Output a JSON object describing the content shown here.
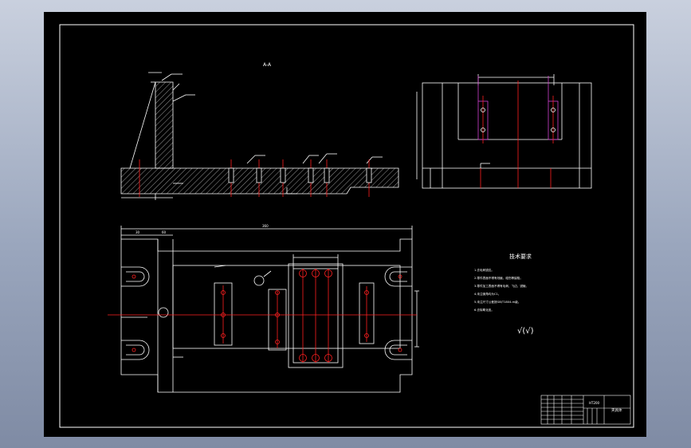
{
  "drawing": {
    "section_label": "A-A",
    "notes_title": "技术要求",
    "notes": [
      "1.去毛刺锐边。",
      "2.零件表面不得有划痕、碰伤等缺陷。",
      "3.零件加工表面不得有毛刺、飞边、锐棱。",
      "4.未注倒角均为C1。",
      "5.未注尺寸公差按GB/T1804-m级。",
      "6.去除氧化皮。"
    ],
    "roughness_symbol": "√(√)",
    "title_block": {
      "part_name": "夹具体",
      "material": "HT200"
    },
    "dimensions": {
      "overall_length": "360",
      "left_offset": "30",
      "pad_width": "60"
    }
  },
  "colors": {
    "background": "#000000",
    "outline": "#ffffff",
    "centerline": "#ff2020",
    "hole_circle": "#ff2020",
    "hatch": "#ffffff",
    "magenta": "#d040d0"
  }
}
